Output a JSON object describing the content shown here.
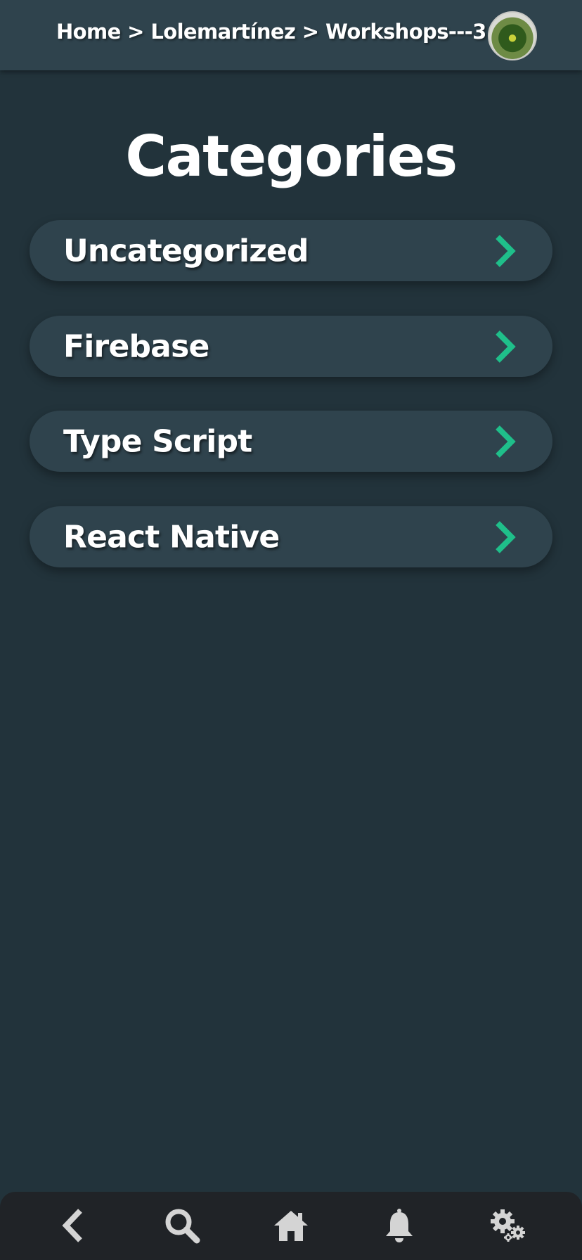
{
  "header": {
    "breadcrumb": "Home > Lolemartínez > Workshops---3",
    "avatar_alt": "User avatar"
  },
  "main": {
    "title": "Categories",
    "categories": [
      {
        "label": "Uncategorized"
      },
      {
        "label": "Firebase"
      },
      {
        "label": "Type Script"
      },
      {
        "label": "React Native"
      }
    ]
  },
  "bottom_nav": {
    "items": [
      {
        "icon": "back-arrow-icon"
      },
      {
        "icon": "search-icon"
      },
      {
        "icon": "home-icon"
      },
      {
        "icon": "bell-icon"
      },
      {
        "icon": "settings-gears-icon"
      }
    ]
  },
  "colors": {
    "background": "#22333b",
    "surface": "#2f434d",
    "nav_background": "#202327",
    "accent": "#1fbf8a",
    "nav_icon": "#d4d4d4"
  }
}
